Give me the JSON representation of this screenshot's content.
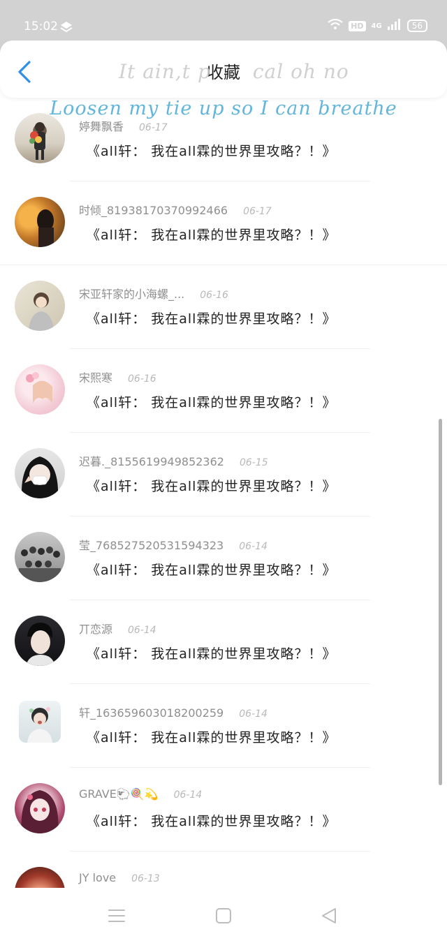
{
  "status_bar": {
    "time": "15:02",
    "network": "4G",
    "hd": "HD",
    "battery": "56"
  },
  "header": {
    "title": "收藏",
    "lyric_line1": "It ain,t p",
    "lyric_line1_tail": "cal oh no",
    "lyric_line2": "Loosen my tie up so I can breathe"
  },
  "messages": [
    {
      "name": "婷舞飘香",
      "date": "06-17",
      "text": "《all轩： 我在all霖的世界里攻略？！》"
    },
    {
      "name": "时倾_819381703709924​66",
      "date": "06-17",
      "text": "《all轩： 我在all霖的世界里攻略？！》"
    },
    {
      "name": "宋亚轩家的小海螺_...",
      "date": "06-16",
      "text": "《all轩： 我在all霖的世界里攻略？！》"
    },
    {
      "name": "宋熙寒",
      "date": "06-16",
      "text": "《all轩： 我在all霖的世界里攻略？！》"
    },
    {
      "name": "迟暮._8155619949852362",
      "date": "06-15",
      "text": "《all轩： 我在all霖的世界里攻略？！》"
    },
    {
      "name": "莹_7685275205315943​23",
      "date": "06-14",
      "text": "《all轩： 我在all霖的世界里攻略？！》"
    },
    {
      "name": "丌恋源",
      "date": "06-14",
      "text": "《all轩： 我在all霖的世界里攻略？！》"
    },
    {
      "name": "轩_163659603018200259",
      "date": "06-14",
      "text": "《all轩： 我在all霖的世界里攻略？！》"
    },
    {
      "name": "GRAVE🐑🍭💫",
      "date": "06-14",
      "text": "《all轩： 我在all霖的世界里攻略？！》"
    },
    {
      "name": "JY love",
      "date": "06-13",
      "text": ""
    }
  ],
  "colors": {
    "accent": "#2f8fe6",
    "lyric": "#62b6dc",
    "status_bar": "#d2d2d2"
  },
  "icons": {
    "back": "back-arrow-icon",
    "menu": "menu-icon",
    "home": "home-icon",
    "recent": "back-triangle-icon"
  }
}
